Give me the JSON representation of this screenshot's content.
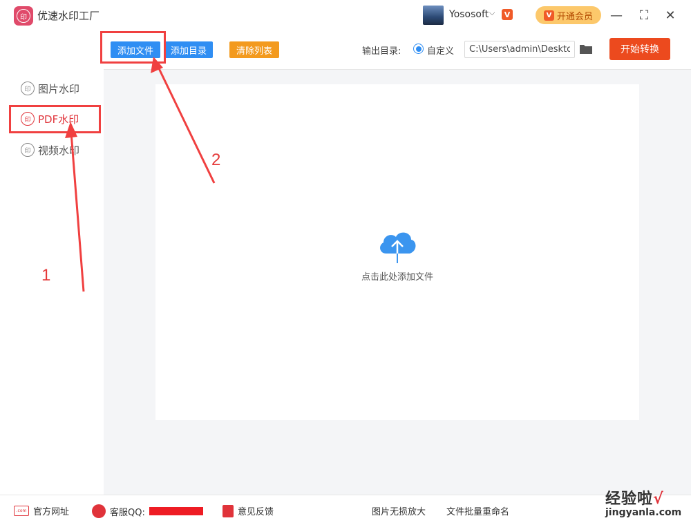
{
  "app": {
    "logo_text": "印",
    "title": "优速水印工厂"
  },
  "user": {
    "name": "Yososoft",
    "chevron": "⌵",
    "vip_badge": "V"
  },
  "vip_button": {
    "label": "开通会员",
    "icon_text": "V"
  },
  "window_controls": {
    "minimize": "—",
    "maximize": "⛶",
    "close": "✕"
  },
  "sidebar": {
    "items": [
      {
        "icon": "印",
        "label": "图片水印",
        "active": false
      },
      {
        "icon": "印",
        "label": "PDF水印",
        "active": true
      },
      {
        "icon": "印",
        "label": "视频水印",
        "active": false
      }
    ]
  },
  "toolbar": {
    "add_file": "添加文件",
    "add_dir": "添加目录",
    "clear_list": "清除列表",
    "output_label": "输出目录:",
    "radio_label": "自定义",
    "output_path": "C:\\Users\\admin\\Deskto",
    "start": "开始转换"
  },
  "dropzone": {
    "text": "点击此处添加文件"
  },
  "footer": {
    "site_icon": ".com",
    "site": "官方网址",
    "qq": "客服QQ:",
    "feedback": "意见反馈",
    "img_upscale": "图片无损放大",
    "batch_rename": "文件批量重命名"
  },
  "annotations": {
    "step1": "1",
    "step2": "2"
  },
  "watermark": {
    "line1": "经验啦",
    "check": "√",
    "line2": "jingyanla.com"
  },
  "colors": {
    "primary_blue": "#2f8ef3",
    "orange": "#f39a1e",
    "start_red": "#ec4a1e",
    "accent_red": "#e0333a",
    "annotation_red": "#f04040"
  }
}
